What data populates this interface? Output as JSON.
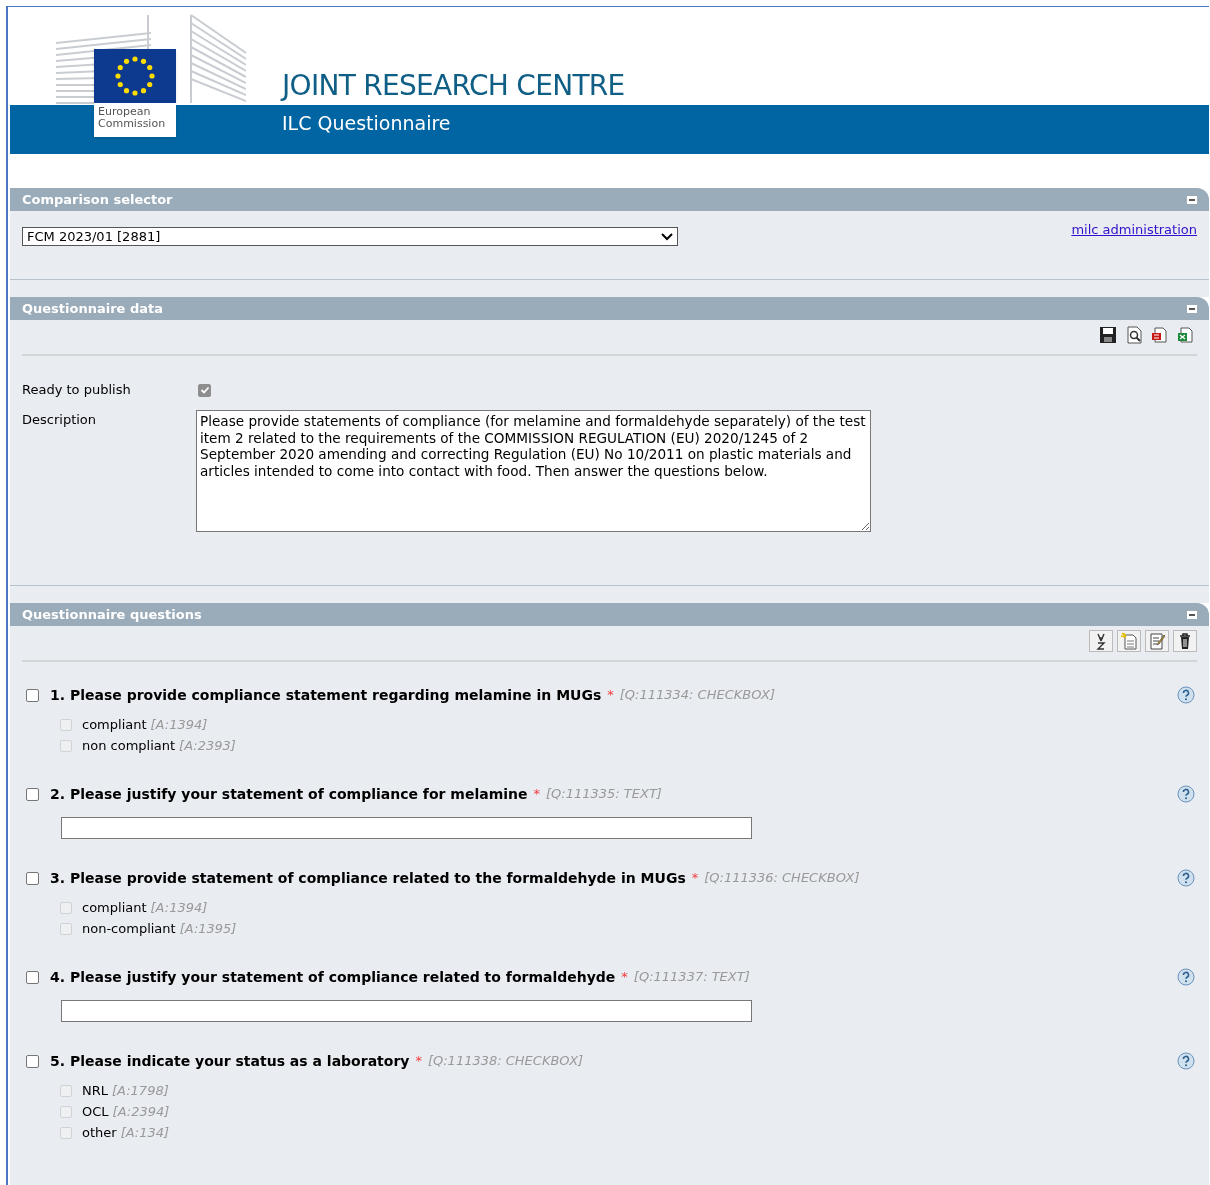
{
  "header": {
    "logo_text": "European Commission",
    "title": "JOINT RESEARCH CENTRE",
    "subtitle": "ILC Questionnaire"
  },
  "comparison_selector": {
    "title": "Comparison selector",
    "selected_value": "FCM 2023/01 [2881]",
    "link": "milc administration"
  },
  "questionnaire_data": {
    "title": "Questionnaire data",
    "ready_label": "Ready to publish",
    "ready_to_publish": true,
    "description_label": "Description",
    "description": "Please provide statements of compliance (for melamine and formaldehyde separately) of the test item 2 related to the requirements of the COMMISSION REGULATION (EU) 2020/1245 of 2 September 2020 amending and correcting Regulation (EU) No 10/2011 on plastic materials and articles intended to come into contact with food. Then answer the questions below."
  },
  "questionnaire_questions": {
    "title": "Questionnaire questions",
    "questions": [
      {
        "number": "1.",
        "text": "Please provide compliance statement regarding melamine in MUGs",
        "required_mark": "*",
        "meta": "[Q:111334: CHECKBOX]",
        "kind": "checkbox",
        "checked": false,
        "options": [
          {
            "label": "compliant",
            "meta": "[A:1394]",
            "checked": false
          },
          {
            "label": "non compliant",
            "meta": "[A:2393]",
            "checked": false
          }
        ]
      },
      {
        "number": "2.",
        "text": "Please justify your statement of compliance for melamine",
        "required_mark": "*",
        "meta": "[Q:111335: TEXT]",
        "kind": "text",
        "checked": false
      },
      {
        "number": "3.",
        "text": "Please provide statement of compliance related to the formaldehyde in MUGs",
        "required_mark": "*",
        "meta": "[Q:111336: CHECKBOX]",
        "kind": "checkbox",
        "checked": false,
        "options": [
          {
            "label": "compliant",
            "meta": "[A:1394]",
            "checked": false
          },
          {
            "label": "non-compliant",
            "meta": "[A:1395]",
            "checked": false
          }
        ]
      },
      {
        "number": "4.",
        "text": "Please justify your statement of compliance related to formaldehyde",
        "required_mark": "*",
        "meta": "[Q:111337: TEXT]",
        "kind": "text",
        "checked": false
      },
      {
        "number": "5.",
        "text": "Please indicate your status as a laboratory",
        "required_mark": "*",
        "meta": "[Q:111338: CHECKBOX]",
        "kind": "checkbox",
        "checked": false,
        "options": [
          {
            "label": "NRL",
            "meta": "[A:1798]",
            "checked": false
          },
          {
            "label": "OCL",
            "meta": "[A:2394]",
            "checked": false
          },
          {
            "label": "other",
            "meta": "[A:134]",
            "checked": false
          }
        ]
      }
    ]
  }
}
